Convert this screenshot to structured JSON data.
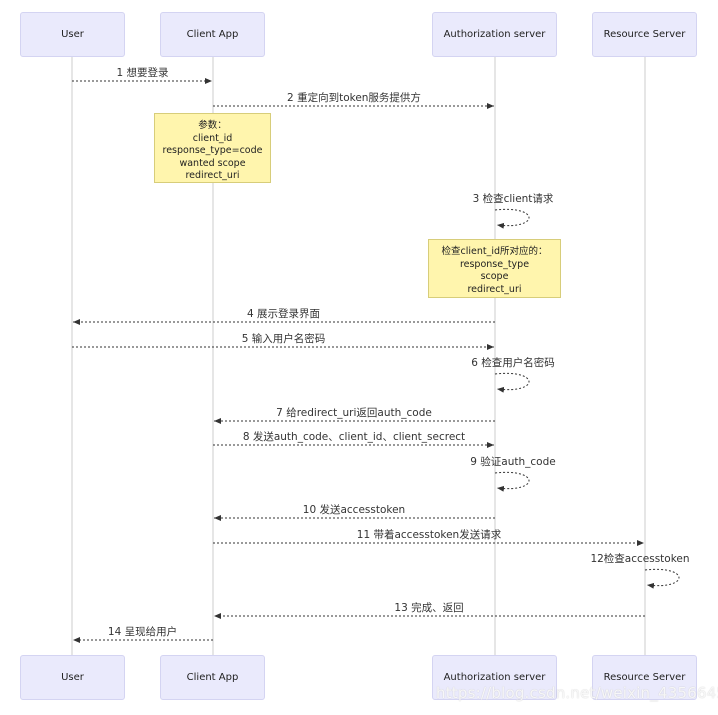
{
  "participants": [
    "User",
    "Client App",
    "Authorization server",
    "Resource Server"
  ],
  "messages": [
    {
      "from": 0,
      "to": 1,
      "text": "1 想要登录"
    },
    {
      "from": 1,
      "to": 2,
      "text": "2 重定向到token服务提供方"
    },
    {
      "from": 2,
      "to": 2,
      "text": "3 检查client请求"
    },
    {
      "from": 2,
      "to": 0,
      "text": "4 展示登录界面"
    },
    {
      "from": 0,
      "to": 2,
      "text": "5 输入用户名密码"
    },
    {
      "from": 2,
      "to": 2,
      "text": "6 检查用户名密码"
    },
    {
      "from": 2,
      "to": 1,
      "text": "7 给redirect_uri返回auth_code"
    },
    {
      "from": 1,
      "to": 2,
      "text": "8 发送auth_code、client_id、client_secrect"
    },
    {
      "from": 2,
      "to": 2,
      "text": "9 验证auth_code"
    },
    {
      "from": 2,
      "to": 1,
      "text": "10 发送accesstoken"
    },
    {
      "from": 1,
      "to": 3,
      "text": "11 带着accesstoken发送请求"
    },
    {
      "from": 3,
      "to": 3,
      "text": "12检查accesstoken"
    },
    {
      "from": 3,
      "to": 1,
      "text": "13 完成、返回"
    },
    {
      "from": 1,
      "to": 0,
      "text": "14 呈现给用户"
    }
  ],
  "notes": [
    {
      "over": 1,
      "lines": [
        "参数：",
        "client_id",
        "response_type=code",
        "wanted scope",
        "redirect_uri"
      ]
    },
    {
      "over": 2,
      "lines": [
        "检查client_id所对应的：",
        "response_type",
        "scope",
        "redirect_uri"
      ]
    }
  ],
  "watermark": "https://blog.csdn.net/weixin_43566459",
  "colors": {
    "actor_fill": "#eaeafc",
    "note_fill": "#fff5ad",
    "lifeline": "#dddddd",
    "arrow": "#333333"
  }
}
